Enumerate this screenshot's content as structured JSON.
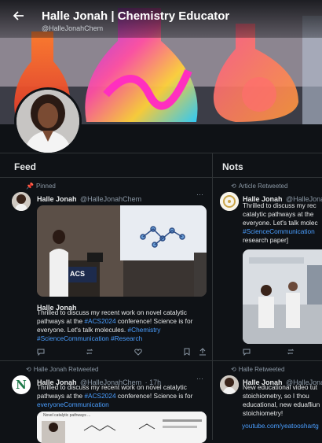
{
  "header": {
    "title": "Halle Jonah | Chemistry Educator",
    "handle": "@HalleJonahChem"
  },
  "columns": {
    "feed_title": "Feed",
    "notes_title": "Nots"
  },
  "feed": {
    "pinned_label": "Pinned",
    "post1": {
      "name": "Halle Jonah",
      "handle": "@HalleJonahChem",
      "slide_badge": "ACS",
      "caption_name": "Halle Jonah",
      "text_plain_1": "Thrilled to discuss my recent work on novel catalytic",
      "text_plain_2a": "pathways at the ",
      "text_link_2": "#ACS2024",
      "text_plain_2b": " conference! Science is for",
      "text_plain_3": "everyone. Let's talk molecules. ",
      "text_link_3": "#Chemistry",
      "text_link_4": "#ScienceCommunication #Research"
    },
    "post2": {
      "retweet_label": "Halle Jonah Retweeted",
      "name": "Halle Jonah",
      "handle": "@HalleJonahChem",
      "time": "· 17h",
      "avatar_letter": "N",
      "text_1": "Thrilled to discuss my recent work on novel catalytic",
      "text_2a": "pathways at the ",
      "text_link_2": "#ACS2024",
      "text_2b": " conference! Science is for",
      "text_link_3": "everyoneCommunication",
      "preview_text": "Novel catalytic pathways ..."
    }
  },
  "notes": {
    "item1": {
      "retweet_label": "Article Retweeted",
      "name": "Halle Jonah",
      "handle": "@HalleJonah",
      "text_1": "Thrilled to discuss my rec",
      "text_2": "catalytic pathways at the",
      "text_3": "everyone. Let's talk molec",
      "text_link_4": "#ScienceCommunication",
      "text_5": "research paper]"
    },
    "item2": {
      "retweet_label": "Halle Retweeted",
      "name": "Halle Jonah",
      "handle": "@HalleJonah",
      "text_1": "New educational video tut",
      "text_2": "stoichiometry, so I thou",
      "text_3": "educational, new eduafliun",
      "text_4": "stoichiometry!",
      "link": "youtube.com/yeatooshartg"
    }
  },
  "colors": {
    "background": "#0f1216",
    "link": "#4a9eff",
    "muted": "#8b98a5"
  }
}
